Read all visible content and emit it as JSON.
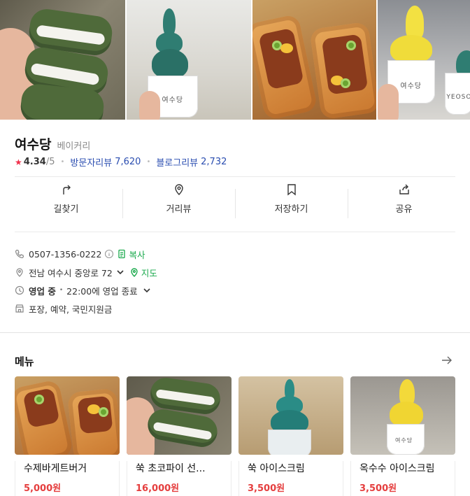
{
  "photos": [
    "photo-green-choco-pie",
    "photo-mugwort-ice-cream",
    "photo-baguette-burger",
    "photo-corn-ice-cream"
  ],
  "photo_text": {
    "cup_brand": "여수당",
    "cup_brand_en": "YEOSOO"
  },
  "place": {
    "name": "여수당",
    "category": "베이커리",
    "rating": "4.34",
    "rating_max": "/5",
    "visitor_review_label": "방문자리뷰",
    "visitor_review_count": "7,620",
    "blog_review_label": "블로그리뷰",
    "blog_review_count": "2,732"
  },
  "actions": [
    {
      "label": "길찾기",
      "icon": "directions-icon"
    },
    {
      "label": "거리뷰",
      "icon": "location-pin-icon"
    },
    {
      "label": "저장하기",
      "icon": "bookmark-icon"
    },
    {
      "label": "공유",
      "icon": "share-icon"
    }
  ],
  "info": {
    "phone": "0507-1356-0222",
    "copy_label": "복사",
    "address": "전남 여수시 중앙로 72",
    "map_label": "지도",
    "status": "영업 중",
    "hours": "22:00에 영업 종료",
    "services": "포장, 예약, 국민지원금"
  },
  "menu": {
    "title": "메뉴",
    "items": [
      {
        "name": "수제바게트버거",
        "price": "5,000원"
      },
      {
        "name": "쑥 초코파이 선...",
        "price": "16,000원"
      },
      {
        "name": "쑥 아이스크림",
        "price": "3,500원"
      },
      {
        "name": "옥수수 아이스크림",
        "price": "3,500원"
      }
    ]
  },
  "colors": {
    "accent_link": "#2a4db0",
    "green": "#1aa94c",
    "price": "#e53e3e",
    "star": "#f0304b"
  }
}
